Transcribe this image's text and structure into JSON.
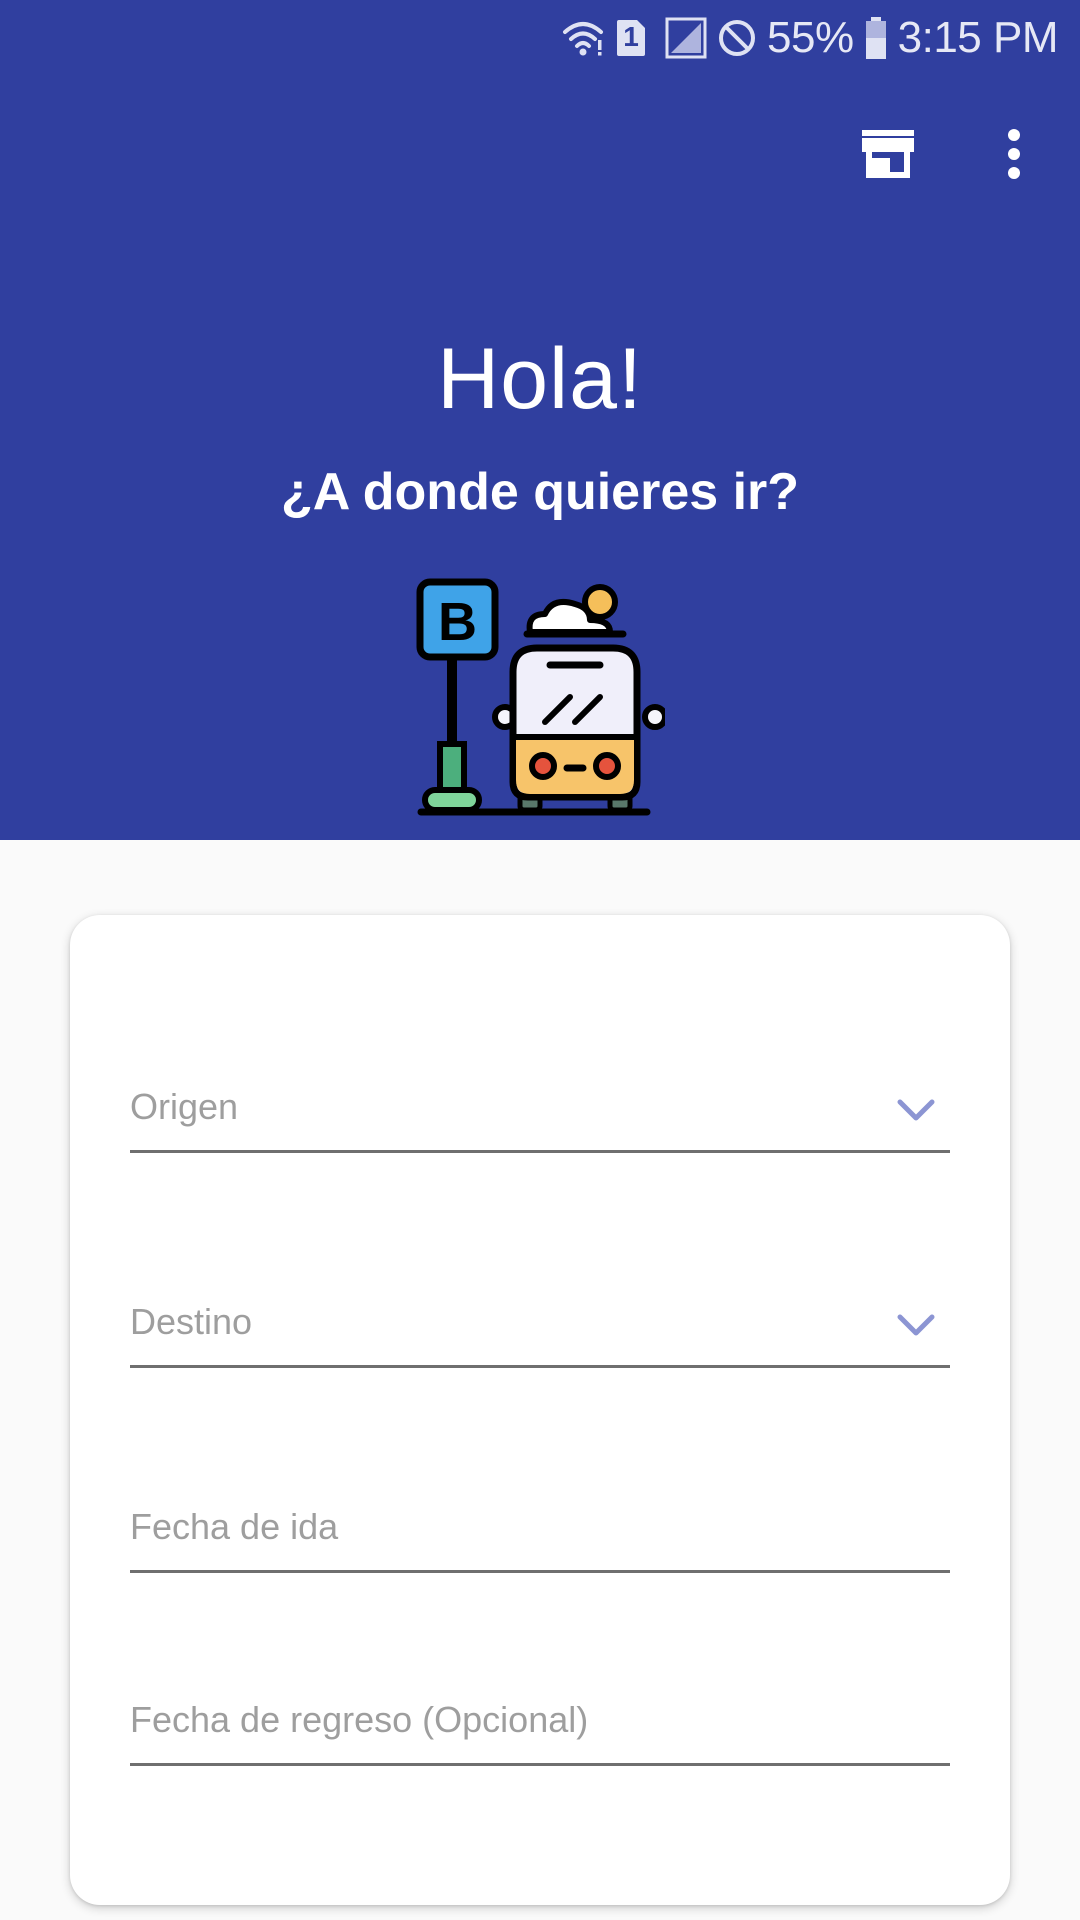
{
  "status_bar": {
    "battery": "55%",
    "time": "3:15 PM",
    "sim_slot": "1",
    "icons": [
      "wifi-icon",
      "sim-1-icon",
      "signal-icon",
      "do-not-disturb-icon",
      "battery-icon"
    ]
  },
  "app_bar": {
    "actions": [
      {
        "name": "store-icon"
      },
      {
        "name": "more-vert-icon"
      }
    ]
  },
  "hero": {
    "greeting": "Hola!",
    "question": "¿A donde quieres ir?",
    "illustration": "bus-stop-illustration",
    "sign_letter": "B"
  },
  "form": {
    "origin_placeholder": "Origen",
    "destination_placeholder": "Destino",
    "departure_placeholder": "Fecha de ida",
    "return_placeholder": "Fecha de regreso (Opcional)"
  },
  "colors": {
    "primary": "#303f9f",
    "background": "#fafafa",
    "card": "#ffffff",
    "chevron": "#8c95d3",
    "placeholder": "#9e9e9e"
  }
}
